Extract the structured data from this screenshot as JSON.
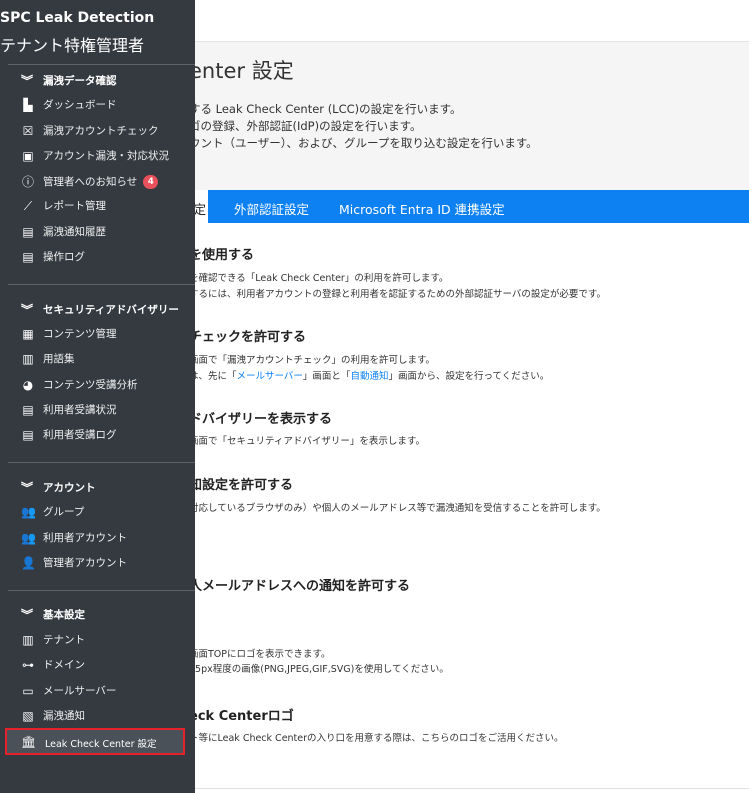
{
  "header": {
    "page_title": "enter 設定",
    "descriptions": [
      "する Leak Check Center (LCC)の設定を行います。",
      "ゴの登録、外部認証(IdP)の設定を行います。",
      "ウント（ユーザー）、および、グループを取り込む設定を行います。"
    ]
  },
  "tabs": [
    {
      "label": "定",
      "active": true
    },
    {
      "label": "外部認証設定",
      "active": false
    },
    {
      "label": "Microsoft Entra ID 連携設定",
      "active": false
    }
  ],
  "sections": [
    {
      "title": "を使用する",
      "lines": [
        "を確認できる「Leak Check Center」の利用を許可します。",
        "するには、利用者アカウントの登録と利用者を認証するための外部認証サーバの設定が必要です。"
      ]
    },
    {
      "title": "チェックを許可する",
      "line1": "画面で「漏洩アカウントチェック」の利用を許可します。",
      "line2_pre": "は、先に「",
      "link1": "メールサーバー",
      "line2_mid": "」画面と「",
      "link2": "自動通知",
      "line2_post": "」画面から、設定を行ってください。"
    },
    {
      "title": "ドバイザリーを表示する",
      "lines": [
        "画面で「セキュリティアドバイザリー」を表示します。"
      ]
    },
    {
      "title": "知設定を許可する",
      "lines": [
        "対応しているブラウザのみ）や個人のメールアドレス等で漏洩通知を受信することを許可します。"
      ]
    },
    {
      "title": "人メールアドレスへの通知を許可する",
      "lines": []
    },
    {
      "title": "",
      "lines": [
        "画面TOPにロゴを表示できます。",
        "45px程度の画像(PNG,JPEG,GIF,SVG)を使用してください。"
      ]
    },
    {
      "title": "eck Centerロゴ",
      "lines": [
        "ト等にLeak Check Centerの入り口を用意する際は、こちらのロゴをご活用ください。"
      ]
    }
  ],
  "sidebar": {
    "brand": "SPC Leak Detection",
    "brand_sub": "テナント特権管理者",
    "groups": [
      {
        "label": "漏洩データ確認",
        "items": [
          {
            "label": "ダッシュボード",
            "icon": "dashboard-icon"
          },
          {
            "label": "漏洩アカウントチェック",
            "icon": "user-slash-icon"
          },
          {
            "label": "アカウント漏洩・対応状況",
            "icon": "user-board-icon"
          },
          {
            "label": "管理者へのお知らせ",
            "icon": "info-icon",
            "badge": "4"
          },
          {
            "label": "レポート管理",
            "icon": "chart-line-icon"
          },
          {
            "label": "漏洩通知履歴",
            "icon": "file-icon"
          },
          {
            "label": "操作ログ",
            "icon": "file-icon"
          }
        ]
      },
      {
        "label": "セキュリティアドバイザリー",
        "items": [
          {
            "label": "コンテンツ管理",
            "icon": "content-icon"
          },
          {
            "label": "用語集",
            "icon": "book-icon"
          },
          {
            "label": "コンテンツ受講分析",
            "icon": "pie-chart-icon"
          },
          {
            "label": "利用者受講状況",
            "icon": "table-icon"
          },
          {
            "label": "利用者受講ログ",
            "icon": "file-icon"
          }
        ]
      },
      {
        "label": "アカウント",
        "items": [
          {
            "label": "グループ",
            "icon": "users-icon"
          },
          {
            "label": "利用者アカウント",
            "icon": "users-cog-icon"
          },
          {
            "label": "管理者アカウント",
            "icon": "user-icon"
          }
        ]
      },
      {
        "label": "基本設定",
        "items": [
          {
            "label": "テナント",
            "icon": "building-icon"
          },
          {
            "label": "ドメイン",
            "icon": "sitemap-icon"
          },
          {
            "label": "メールサーバー",
            "icon": "desktop-icon"
          },
          {
            "label": "漏洩通知",
            "icon": "bell-icon"
          }
        ]
      }
    ],
    "active_item": {
      "label": "Leak Check Center 設定",
      "icon": "landmark-icon"
    }
  }
}
